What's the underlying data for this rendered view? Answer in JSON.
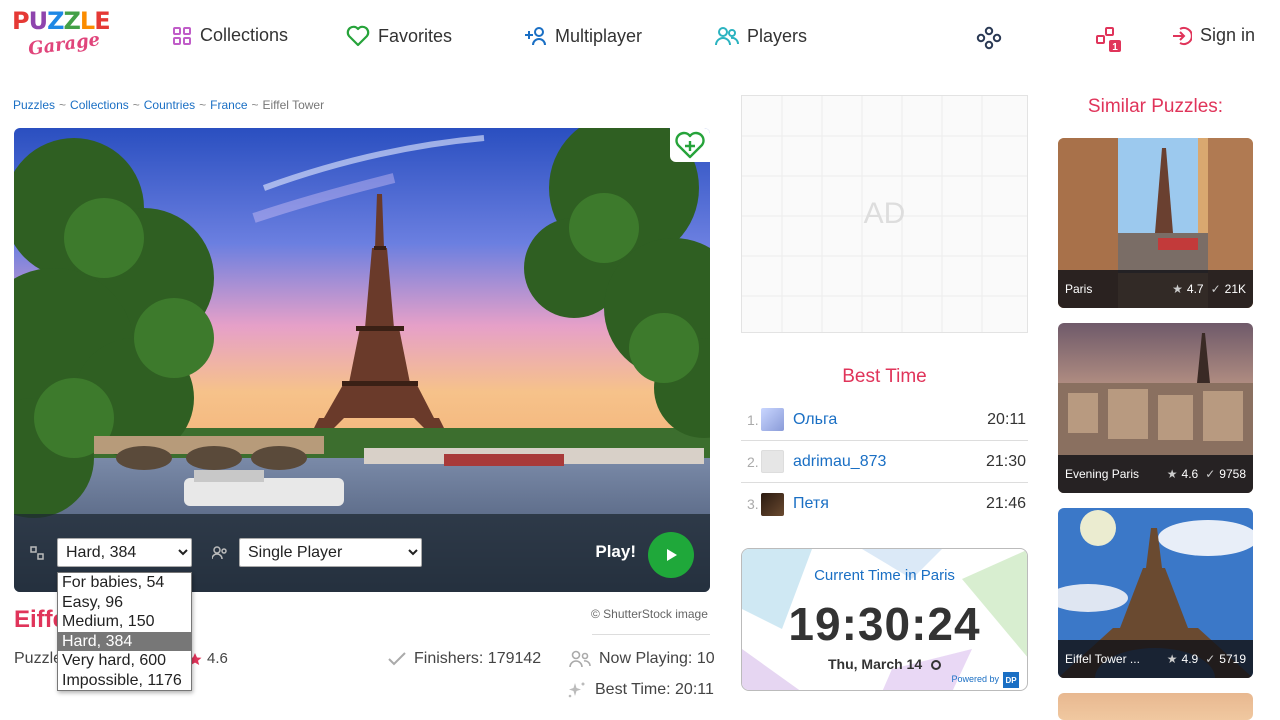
{
  "header": {
    "logo_top": "PUZZLE",
    "logo_bottom": "Garage",
    "nav": [
      {
        "label": "Collections",
        "icon": "grid-icon"
      },
      {
        "label": "Favorites",
        "icon": "heart-icon"
      },
      {
        "label": "Multiplayer",
        "icon": "add-user-icon"
      },
      {
        "label": "Players",
        "icon": "users-icon"
      }
    ],
    "sign_in": "Sign in"
  },
  "breadcrumb": [
    "Puzzles",
    "Collections",
    "Countries",
    "France",
    "Eiffel Tower"
  ],
  "controls": {
    "difficulty_selected": "Hard, 384",
    "mode_selected": "Single Player",
    "play_label": "Play!"
  },
  "difficulty_options": [
    "For babies, 54",
    "Easy, 96",
    "Medium, 150",
    "Hard, 384",
    "Very hard, 600",
    "Impossible, 1176"
  ],
  "puzzle": {
    "title": "Eiffel Tower",
    "label_prefix": "Puzzle",
    "rating": "4.6",
    "credit": "© ShutterStock image",
    "finishers": "Finishers: 179142",
    "now_playing": "Now Playing: 10",
    "best_time": "Best Time: 20:11"
  },
  "ad": {
    "text": "AD"
  },
  "best_time": {
    "title": "Best Time",
    "rows": [
      {
        "rank": "1.",
        "name": "Ольга",
        "time": "20:11"
      },
      {
        "rank": "2.",
        "name": "adrimau_873",
        "time": "21:30"
      },
      {
        "rank": "3.",
        "name": "Петя",
        "time": "21:46"
      }
    ]
  },
  "clock": {
    "title": "Current Time in Paris",
    "time": "19:30:24",
    "date": "Thu, March 14",
    "powered": "Powered by",
    "badge": "DP"
  },
  "similar": {
    "title": "Similar Puzzles:",
    "items": [
      {
        "name": "Paris",
        "rating": "4.7",
        "count": "21K"
      },
      {
        "name": "Evening Paris",
        "rating": "4.6",
        "count": "9758"
      },
      {
        "name": "Eiffel Tower ...",
        "rating": "4.9",
        "count": "5719"
      }
    ]
  },
  "colors": {
    "accent": "#e0345a",
    "link": "#1a6fc4",
    "play": "#1fa83a"
  }
}
